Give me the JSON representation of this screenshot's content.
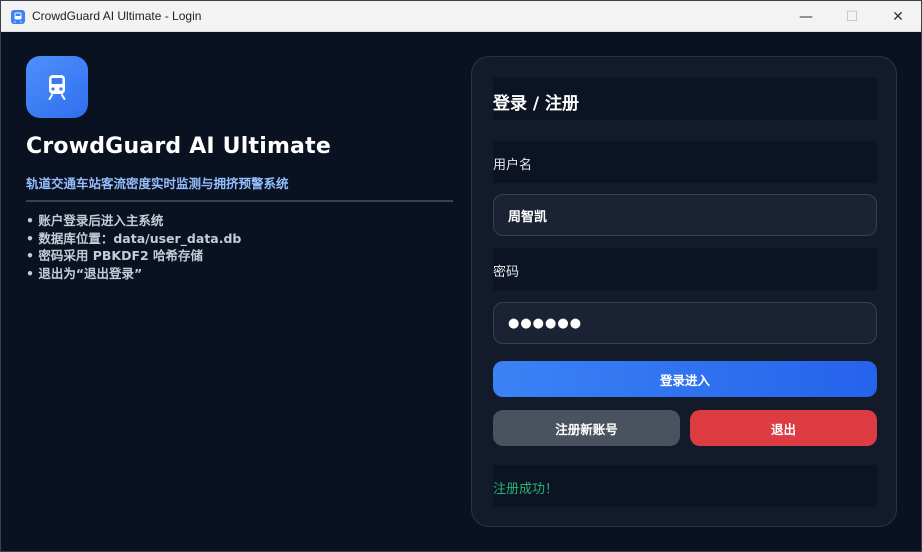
{
  "window": {
    "title": "CrowdGuard AI Ultimate - Login",
    "controls": {
      "minimize": "—",
      "maximize": "☐",
      "close": "✕"
    }
  },
  "brand": {
    "logo_icon": "train-icon",
    "accent_color": "#3b82f6",
    "app_name": "CrowdGuard AI Ultimate",
    "subtitle": "轨道交通车站客流密度实时监测与拥挤预警系统"
  },
  "info_items": [
    "• 账户登录后进入主系统",
    "• 数据库位置：data/user_data.db",
    "• 密码采用 PBKDF2 哈希存储",
    "• 退出为“退出登录”"
  ],
  "form": {
    "title": "登录 / 注册",
    "username_label": "用户名",
    "username_value": "周智凯",
    "password_label": "密码",
    "password_value": "●●●●●●",
    "login_button": "登录进入",
    "register_button": "注册新账号",
    "exit_button": "退出",
    "status_message": "注册成功！",
    "status_color": "#22b573",
    "danger_color": "#dc3c42"
  }
}
